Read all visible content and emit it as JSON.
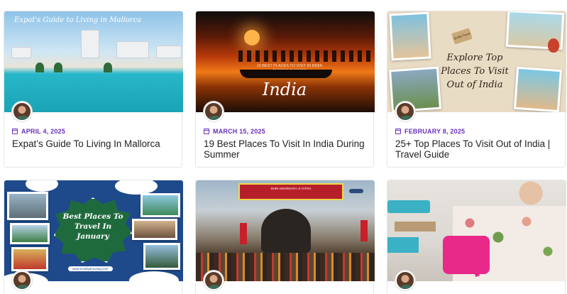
{
  "posts": [
    {
      "date": "APRIL 4, 2025",
      "title": "Expat’s Guide To Living In Mallorca",
      "image_caption": "Expat's Guide to Living in Mallorca"
    },
    {
      "date": "MARCH 15, 2025",
      "title": "19 Best Places To Visit In India During Summer",
      "image_subtitle": "19 BEST PLACES TO VISIT IN INDIA DURING SUMMER",
      "image_script": "India"
    },
    {
      "date": "FEBRUARY 8, 2025",
      "title": "25+ Top Places To Visit Out of India | Travel Guide",
      "image_headline": "Explore Top Places To Visit Out of India",
      "image_tag": "Quality Travel"
    },
    {
      "image_badge": "Best Places To Travel In January",
      "image_url": "www.mostlyamusing.com"
    },
    {
      "image_banner": "SHRI AMARNATH JI YATRA"
    },
    {}
  ],
  "icons": {
    "date_icon": "calendar-icon",
    "avatar": "author-avatar"
  },
  "colors": {
    "accent": "#6a2fbf",
    "title": "#1f1f1f",
    "border": "#e6e6e6"
  }
}
